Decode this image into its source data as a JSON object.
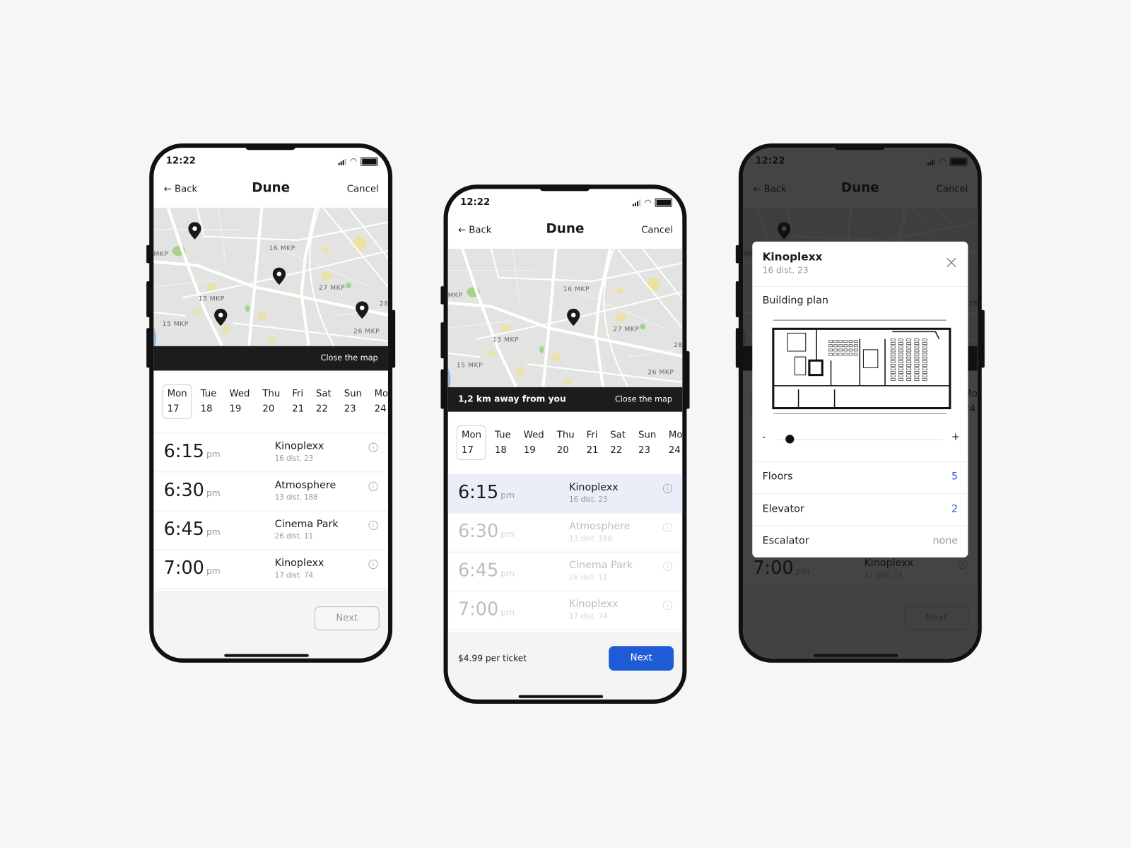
{
  "colors": {
    "accent": "#1f5bd6",
    "highlight_row": "#e9eef9",
    "map_bar": "#1c1c1c",
    "value_blue": "#2a5bd7"
  },
  "status": {
    "time": "12:22",
    "icons": [
      "location-arrow-icon",
      "signal-icon",
      "wifi-icon",
      "battery-icon"
    ]
  },
  "nav": {
    "back": "← Back",
    "title": "Dune",
    "cancel": "Cancel"
  },
  "map": {
    "labels": [
      "MKP",
      "16 MKP",
      "13 MKP",
      "15 MKP",
      "27 MKP",
      "26 MKP",
      "28"
    ],
    "close_label": "Close the map",
    "distance_label": "1,2 km away from you"
  },
  "days": [
    {
      "dow": "Mon",
      "num": "17"
    },
    {
      "dow": "Tue",
      "num": "18"
    },
    {
      "dow": "Wed",
      "num": "19"
    },
    {
      "dow": "Thu",
      "num": "20"
    },
    {
      "dow": "Fri",
      "num": "21"
    },
    {
      "dow": "Sat",
      "num": "22"
    },
    {
      "dow": "Sun",
      "num": "23"
    },
    {
      "dow": "Mo",
      "num": "24"
    }
  ],
  "selected_day": "Mon 17",
  "showtimes": [
    {
      "time": "6:15",
      "ampm": "pm",
      "cinema": "Kinoplexx",
      "address": "16 dist. 23"
    },
    {
      "time": "6:30",
      "ampm": "pm",
      "cinema": "Atmosphere",
      "address": "13 dist. 188"
    },
    {
      "time": "6:45",
      "ampm": "pm",
      "cinema": "Cinema Park",
      "address": "26 dist. 11"
    },
    {
      "time": "7:00",
      "ampm": "pm",
      "cinema": "Kinoplexx",
      "address": "17 dist. 74"
    }
  ],
  "footer": {
    "next": "Next",
    "price": "$4.99 per ticket"
  },
  "modal": {
    "title": "Kinoplexx",
    "subtitle": "16 dist. 23",
    "section": "Building plan",
    "slider": {
      "minus": "-",
      "plus": "+",
      "value": 0.05
    },
    "rows": [
      {
        "label": "Floors",
        "value": "5"
      },
      {
        "label": "Elevator",
        "value": "2"
      },
      {
        "label": "Escalator",
        "value": "none"
      }
    ]
  }
}
